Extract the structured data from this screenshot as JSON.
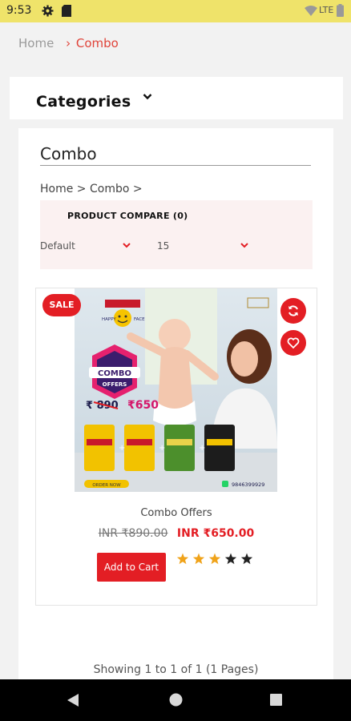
{
  "status_bar": {
    "time": "9:53",
    "network": "LTE"
  },
  "breadcrumb_top": {
    "home": "Home",
    "separator": "›",
    "current": "Combo"
  },
  "categories": {
    "label": "Categories"
  },
  "page": {
    "title": "Combo",
    "breadcrumb": "Home > Combo >",
    "compare_link": "PRODUCT COMPARE (0)",
    "sort": {
      "selected": "Default"
    },
    "limit": {
      "selected": "15"
    }
  },
  "product": {
    "badge": "SALE",
    "name": "Combo Offers",
    "old_price": "INR ₹890.00",
    "new_price": "INR ₹650.00",
    "add_to_cart": "Add to Cart",
    "rating": 3,
    "rating_max": 5,
    "image": {
      "top_label_left": "HAPPY",
      "top_label_right": "FACE",
      "banner_line1": "COMBO",
      "banner_line2": "OFFERS",
      "old_price_text": "₹ 890",
      "new_price_text": "₹650",
      "button_text": "ORDER NOW",
      "phone": "9846399929"
    }
  },
  "pagination": {
    "text": "Showing 1 to 1 of 1 (1 Pages)"
  },
  "colors": {
    "accent": "#e31e24",
    "status_bar": "#efe36a",
    "star_filled": "#f0a31a",
    "star_empty": "#222222"
  }
}
